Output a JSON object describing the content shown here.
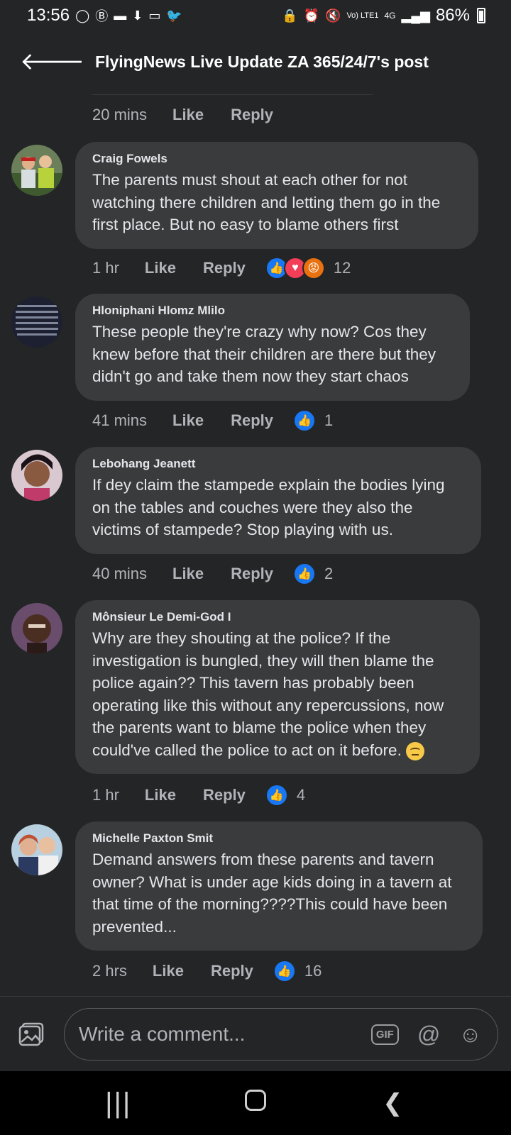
{
  "status_bar": {
    "time": "13:56",
    "signal_text": "Vo) LTE1",
    "network": "4G",
    "battery": "86%"
  },
  "header": {
    "title": "FlyingNews Live Update ZA 365/24/7's post"
  },
  "prev_comment_meta": {
    "time": "20 mins",
    "like": "Like",
    "reply": "Reply"
  },
  "comments": [
    {
      "author": "Craig Fowels",
      "text": "The parents must shout at each other for not watching there children and letting them go in the first place. But no easy to blame others first",
      "time": "1 hr",
      "like": "Like",
      "reply": "Reply",
      "reaction_count": "12"
    },
    {
      "author": "Hloniphani Hlomz Mlilo",
      "text": "These people they're crazy why now? Cos they knew before that their children are there but they didn't go and take them now they start chaos",
      "time": "41 mins",
      "like": "Like",
      "reply": "Reply",
      "reaction_count": "1"
    },
    {
      "author": "Lebohang Jeanett",
      "text": "If dey claim the stampede explain the bodies lying on the tables and couches were they also the victims of stampede?  Stop playing with us.",
      "time": "40 mins",
      "like": "Like",
      "reply": "Reply",
      "reaction_count": "2"
    },
    {
      "author": "Mônsieur Le Demi-God I",
      "text": "Why are they shouting at the police? If the investigation is bungled, they will then blame the police again?? This tavern has probably been operating like this without any repercussions, now the parents want to blame the police when they could've called the police to act on it before.",
      "time": "1 hr",
      "like": "Like",
      "reply": "Reply",
      "reaction_count": "4"
    },
    {
      "author": "Michelle Paxton Smit",
      "text": "Demand answers from these parents and tavern owner? What is under age kids doing in a tavern at that time of the morning????This could have been prevented...",
      "time": "2 hrs",
      "like": "Like",
      "reply": "Reply",
      "reaction_count": "16"
    }
  ],
  "composer": {
    "placeholder": "Write a comment...",
    "gif_label": "GIF"
  },
  "colors": {
    "background": "#242526",
    "bubble": "#3a3b3c",
    "like_blue": "#1877f2",
    "love_red": "#f33e58",
    "angry_orange": "#e9710f"
  }
}
